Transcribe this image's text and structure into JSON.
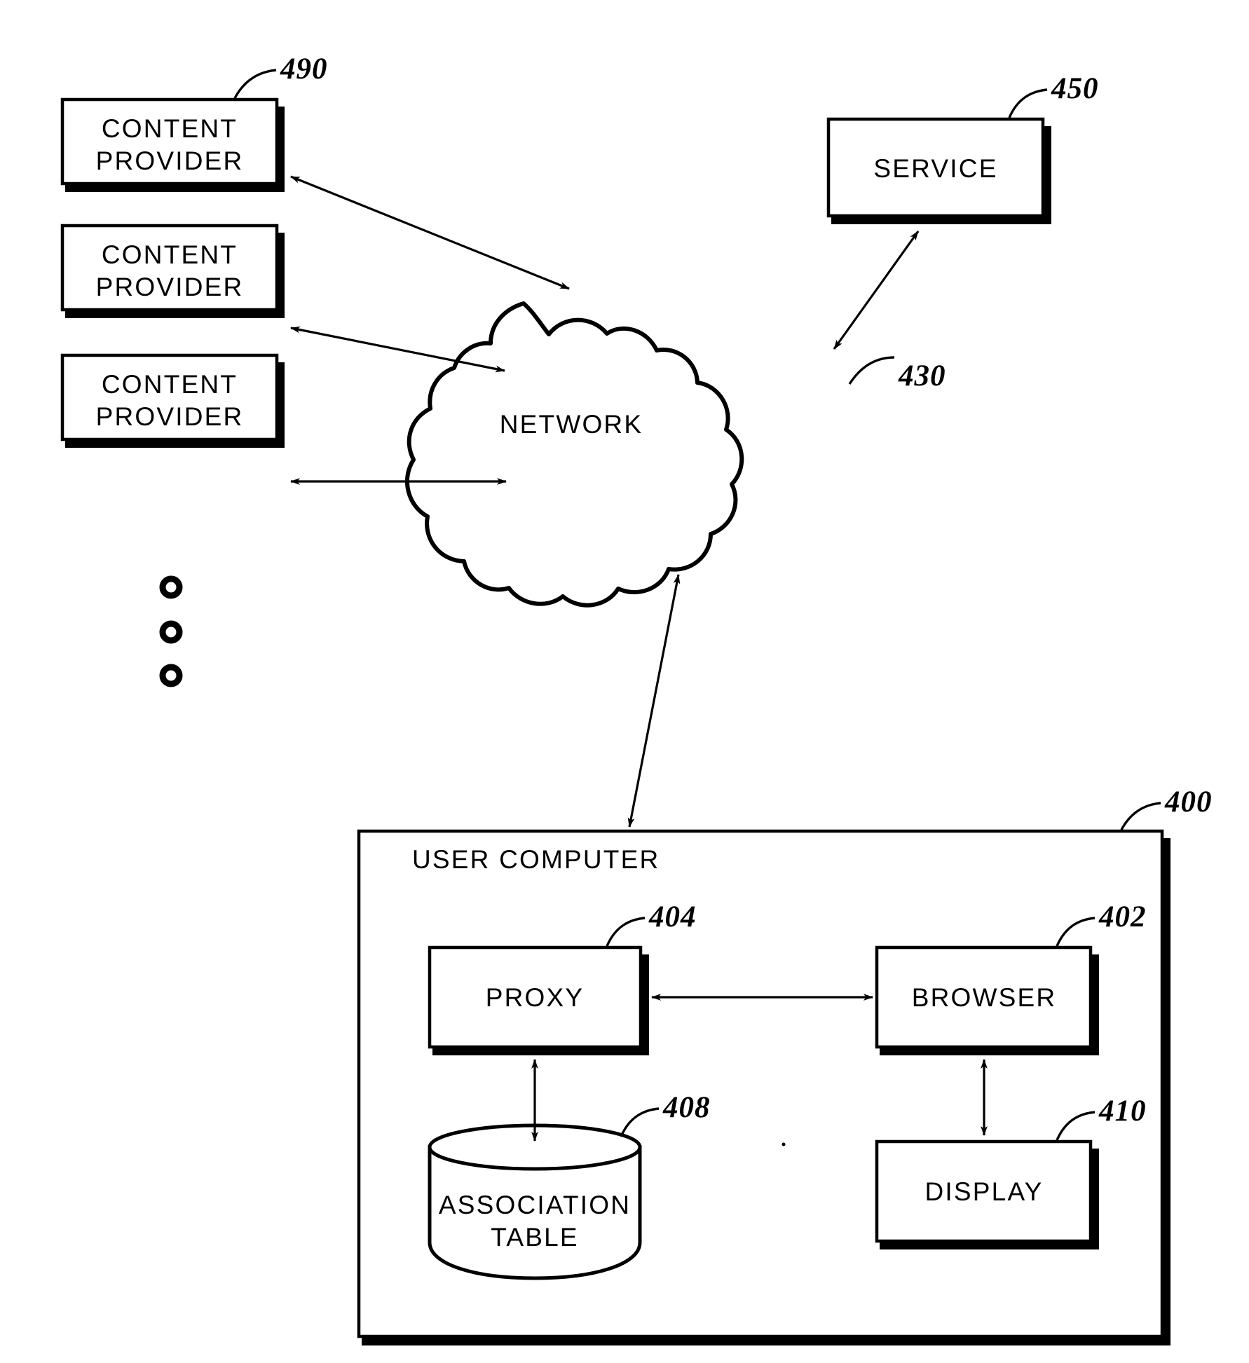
{
  "figure": {
    "nodes": {
      "content_provider_1": {
        "label_line1": "CONTENT",
        "label_line2": "PROVIDER",
        "ref": "490"
      },
      "content_provider_2": {
        "label_line1": "CONTENT",
        "label_line2": "PROVIDER"
      },
      "content_provider_3": {
        "label_line1": "CONTENT",
        "label_line2": "PROVIDER"
      },
      "service": {
        "label": "SERVICE",
        "ref": "450"
      },
      "network": {
        "label": "NETWORK",
        "ref": "430"
      },
      "user_computer": {
        "label": "USER COMPUTER",
        "ref": "400"
      },
      "proxy": {
        "label": "PROXY",
        "ref": "404"
      },
      "browser": {
        "label": "BROWSER",
        "ref": "402"
      },
      "association_table": {
        "label_line1": "ASSOCIATION",
        "label_line2": "TABLE",
        "ref": "408"
      },
      "display": {
        "label": "DISPLAY",
        "ref": "410"
      }
    },
    "ellipsis": {
      "count": 3
    },
    "colors": {
      "ink": "#000000",
      "paper": "#ffffff"
    }
  }
}
